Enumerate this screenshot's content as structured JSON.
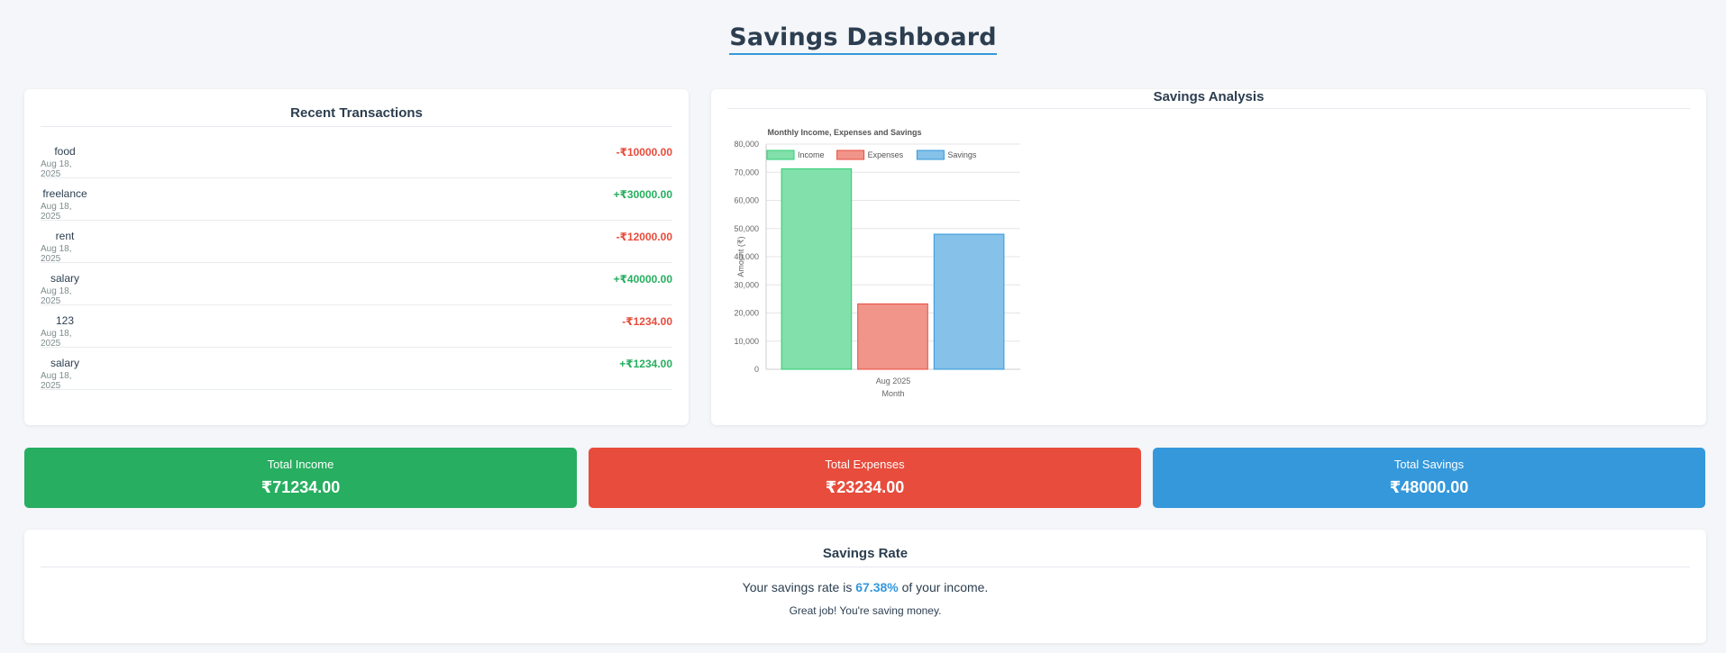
{
  "page": {
    "title": "Savings Dashboard"
  },
  "transactions": {
    "title": "Recent Transactions",
    "items": [
      {
        "desc": "food",
        "date": "Aug 18, 2025",
        "amount": "-₹10000.00",
        "type": "neg"
      },
      {
        "desc": "freelance",
        "date": "Aug 18, 2025",
        "amount": "+₹30000.00",
        "type": "pos"
      },
      {
        "desc": "rent",
        "date": "Aug 18, 2025",
        "amount": "-₹12000.00",
        "type": "neg"
      },
      {
        "desc": "salary",
        "date": "Aug 18, 2025",
        "amount": "+₹40000.00",
        "type": "pos"
      },
      {
        "desc": "123",
        "date": "Aug 18, 2025",
        "amount": "-₹1234.00",
        "type": "neg"
      },
      {
        "desc": "salary",
        "date": "Aug 18, 2025",
        "amount": "+₹1234.00",
        "type": "pos"
      }
    ]
  },
  "analysis": {
    "title": "Savings Analysis"
  },
  "chart_data": {
    "type": "bar",
    "title": "Monthly Income, Expenses and Savings",
    "categories": [
      "Aug 2025"
    ],
    "series": [
      {
        "name": "Income",
        "values": [
          71234
        ],
        "color": "#82e0aa",
        "border": "#2ecc71"
      },
      {
        "name": "Expenses",
        "values": [
          23234
        ],
        "color": "#f1948a",
        "border": "#e74c3c"
      },
      {
        "name": "Savings",
        "values": [
          48000
        ],
        "color": "#85c1e9",
        "border": "#3498db"
      }
    ],
    "xlabel": "Month",
    "ylabel": "Amount (₹)",
    "ylim": [
      0,
      80000
    ],
    "yticks": [
      "0",
      "10,000",
      "20,000",
      "30,000",
      "40,000",
      "50,000",
      "60,000",
      "70,000",
      "80,000"
    ],
    "grid": true,
    "legend": "top"
  },
  "summary": {
    "income": {
      "label": "Total Income",
      "value": "₹71234.00"
    },
    "expenses": {
      "label": "Total Expenses",
      "value": "₹23234.00"
    },
    "savings": {
      "label": "Total Savings",
      "value": "₹48000.00"
    }
  },
  "savings_rate": {
    "title": "Savings Rate",
    "prefix": "Your savings rate is ",
    "percent": "67.38%",
    "suffix": " of your income.",
    "message": "Great job! You're saving money."
  },
  "colors": {
    "income": "#27ae60",
    "expenses": "#e74c3c",
    "savings": "#3498db"
  }
}
